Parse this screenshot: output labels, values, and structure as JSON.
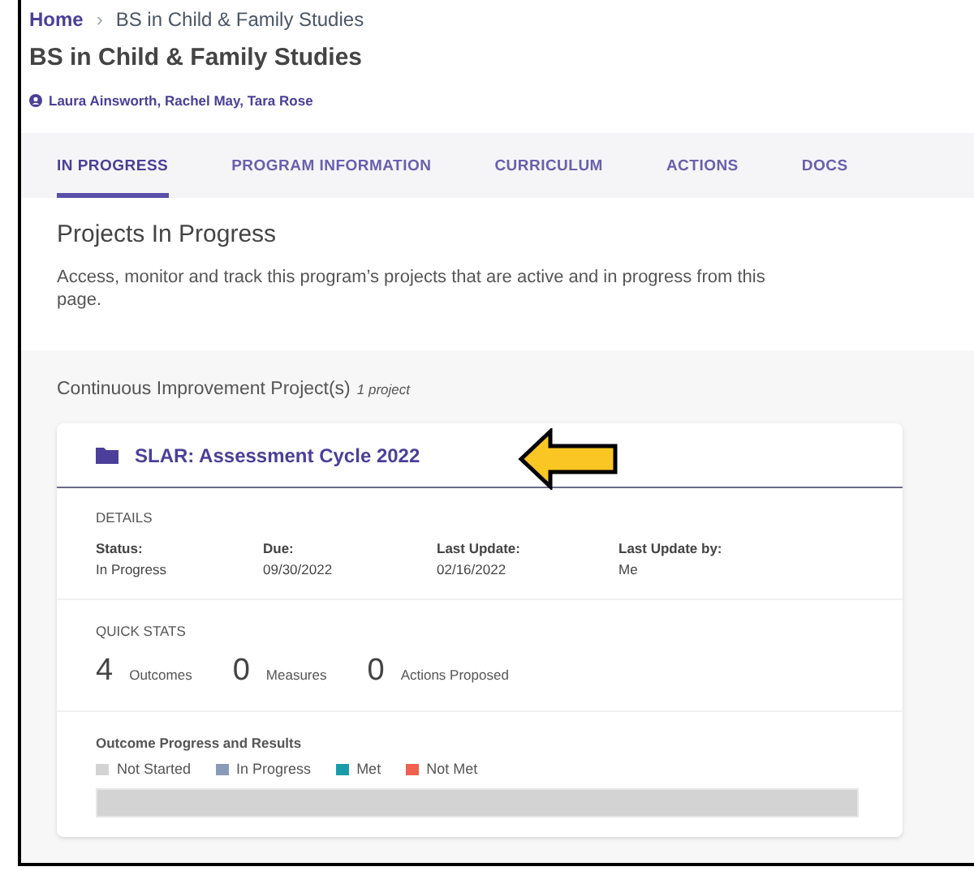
{
  "breadcrumb": {
    "home": "Home",
    "separator": "›",
    "current": "BS in Child & Family Studies"
  },
  "title": "BS in Child & Family Studies",
  "owners": "Laura Ainsworth, Rachel May, Tara Rose",
  "tabs": [
    {
      "label": "IN PROGRESS",
      "selected": true
    },
    {
      "label": "PROGRAM INFORMATION",
      "selected": false
    },
    {
      "label": "CURRICULUM",
      "selected": false
    },
    {
      "label": "ACTIONS",
      "selected": false
    },
    {
      "label": "DOCS",
      "selected": false
    }
  ],
  "section": {
    "title": "Projects In Progress",
    "description": "Access, monitor and track this program’s projects that are active and in progress from this page."
  },
  "projects_heading": {
    "label": "Continuous Improvement Project(s)",
    "count": "1 project"
  },
  "project": {
    "title": "SLAR: Assessment Cycle 2022",
    "details_heading": "DETAILS",
    "details": [
      {
        "label": "Status:",
        "value": "In Progress"
      },
      {
        "label": "Due:",
        "value": "09/30/2022"
      },
      {
        "label": "Last Update:",
        "value": "02/16/2022"
      },
      {
        "label": "Last Update by:",
        "value": "Me"
      }
    ],
    "stats_heading": "QUICK STATS",
    "stats": [
      {
        "number": "4",
        "label": "Outcomes"
      },
      {
        "number": "0",
        "label": "Measures"
      },
      {
        "number": "0",
        "label": "Actions Proposed"
      }
    ],
    "progress_heading": "Outcome Progress and Results",
    "legend": [
      {
        "label": "Not Started",
        "color": "#d3d3d3"
      },
      {
        "label": "In Progress",
        "color": "#8a9bb8"
      },
      {
        "label": "Met",
        "color": "#1a9ba8"
      },
      {
        "label": "Not Met",
        "color": "#f0604d"
      }
    ],
    "progress_bar": {
      "level": 1
    }
  }
}
